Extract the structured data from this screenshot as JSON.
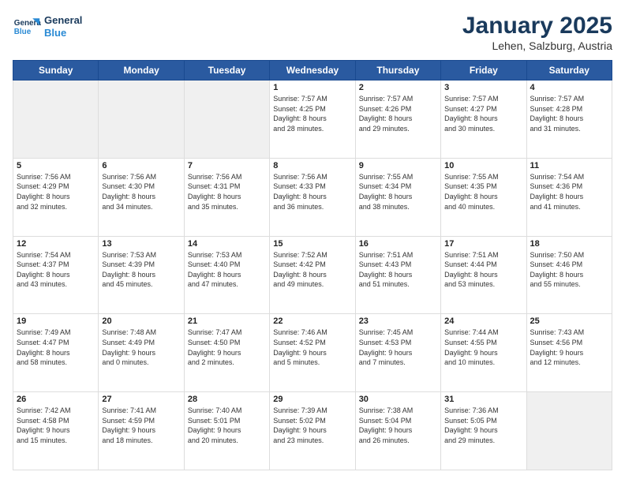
{
  "header": {
    "logo_line1": "General",
    "logo_line2": "Blue",
    "month": "January 2025",
    "location": "Lehen, Salzburg, Austria"
  },
  "weekdays": [
    "Sunday",
    "Monday",
    "Tuesday",
    "Wednesday",
    "Thursday",
    "Friday",
    "Saturday"
  ],
  "weeks": [
    [
      {
        "day": "",
        "text": ""
      },
      {
        "day": "",
        "text": ""
      },
      {
        "day": "",
        "text": ""
      },
      {
        "day": "1",
        "text": "Sunrise: 7:57 AM\nSunset: 4:25 PM\nDaylight: 8 hours\nand 28 minutes."
      },
      {
        "day": "2",
        "text": "Sunrise: 7:57 AM\nSunset: 4:26 PM\nDaylight: 8 hours\nand 29 minutes."
      },
      {
        "day": "3",
        "text": "Sunrise: 7:57 AM\nSunset: 4:27 PM\nDaylight: 8 hours\nand 30 minutes."
      },
      {
        "day": "4",
        "text": "Sunrise: 7:57 AM\nSunset: 4:28 PM\nDaylight: 8 hours\nand 31 minutes."
      }
    ],
    [
      {
        "day": "5",
        "text": "Sunrise: 7:56 AM\nSunset: 4:29 PM\nDaylight: 8 hours\nand 32 minutes."
      },
      {
        "day": "6",
        "text": "Sunrise: 7:56 AM\nSunset: 4:30 PM\nDaylight: 8 hours\nand 34 minutes."
      },
      {
        "day": "7",
        "text": "Sunrise: 7:56 AM\nSunset: 4:31 PM\nDaylight: 8 hours\nand 35 minutes."
      },
      {
        "day": "8",
        "text": "Sunrise: 7:56 AM\nSunset: 4:33 PM\nDaylight: 8 hours\nand 36 minutes."
      },
      {
        "day": "9",
        "text": "Sunrise: 7:55 AM\nSunset: 4:34 PM\nDaylight: 8 hours\nand 38 minutes."
      },
      {
        "day": "10",
        "text": "Sunrise: 7:55 AM\nSunset: 4:35 PM\nDaylight: 8 hours\nand 40 minutes."
      },
      {
        "day": "11",
        "text": "Sunrise: 7:54 AM\nSunset: 4:36 PM\nDaylight: 8 hours\nand 41 minutes."
      }
    ],
    [
      {
        "day": "12",
        "text": "Sunrise: 7:54 AM\nSunset: 4:37 PM\nDaylight: 8 hours\nand 43 minutes."
      },
      {
        "day": "13",
        "text": "Sunrise: 7:53 AM\nSunset: 4:39 PM\nDaylight: 8 hours\nand 45 minutes."
      },
      {
        "day": "14",
        "text": "Sunrise: 7:53 AM\nSunset: 4:40 PM\nDaylight: 8 hours\nand 47 minutes."
      },
      {
        "day": "15",
        "text": "Sunrise: 7:52 AM\nSunset: 4:42 PM\nDaylight: 8 hours\nand 49 minutes."
      },
      {
        "day": "16",
        "text": "Sunrise: 7:51 AM\nSunset: 4:43 PM\nDaylight: 8 hours\nand 51 minutes."
      },
      {
        "day": "17",
        "text": "Sunrise: 7:51 AM\nSunset: 4:44 PM\nDaylight: 8 hours\nand 53 minutes."
      },
      {
        "day": "18",
        "text": "Sunrise: 7:50 AM\nSunset: 4:46 PM\nDaylight: 8 hours\nand 55 minutes."
      }
    ],
    [
      {
        "day": "19",
        "text": "Sunrise: 7:49 AM\nSunset: 4:47 PM\nDaylight: 8 hours\nand 58 minutes."
      },
      {
        "day": "20",
        "text": "Sunrise: 7:48 AM\nSunset: 4:49 PM\nDaylight: 9 hours\nand 0 minutes."
      },
      {
        "day": "21",
        "text": "Sunrise: 7:47 AM\nSunset: 4:50 PM\nDaylight: 9 hours\nand 2 minutes."
      },
      {
        "day": "22",
        "text": "Sunrise: 7:46 AM\nSunset: 4:52 PM\nDaylight: 9 hours\nand 5 minutes."
      },
      {
        "day": "23",
        "text": "Sunrise: 7:45 AM\nSunset: 4:53 PM\nDaylight: 9 hours\nand 7 minutes."
      },
      {
        "day": "24",
        "text": "Sunrise: 7:44 AM\nSunset: 4:55 PM\nDaylight: 9 hours\nand 10 minutes."
      },
      {
        "day": "25",
        "text": "Sunrise: 7:43 AM\nSunset: 4:56 PM\nDaylight: 9 hours\nand 12 minutes."
      }
    ],
    [
      {
        "day": "26",
        "text": "Sunrise: 7:42 AM\nSunset: 4:58 PM\nDaylight: 9 hours\nand 15 minutes."
      },
      {
        "day": "27",
        "text": "Sunrise: 7:41 AM\nSunset: 4:59 PM\nDaylight: 9 hours\nand 18 minutes."
      },
      {
        "day": "28",
        "text": "Sunrise: 7:40 AM\nSunset: 5:01 PM\nDaylight: 9 hours\nand 20 minutes."
      },
      {
        "day": "29",
        "text": "Sunrise: 7:39 AM\nSunset: 5:02 PM\nDaylight: 9 hours\nand 23 minutes."
      },
      {
        "day": "30",
        "text": "Sunrise: 7:38 AM\nSunset: 5:04 PM\nDaylight: 9 hours\nand 26 minutes."
      },
      {
        "day": "31",
        "text": "Sunrise: 7:36 AM\nSunset: 5:05 PM\nDaylight: 9 hours\nand 29 minutes."
      },
      {
        "day": "",
        "text": ""
      }
    ]
  ]
}
